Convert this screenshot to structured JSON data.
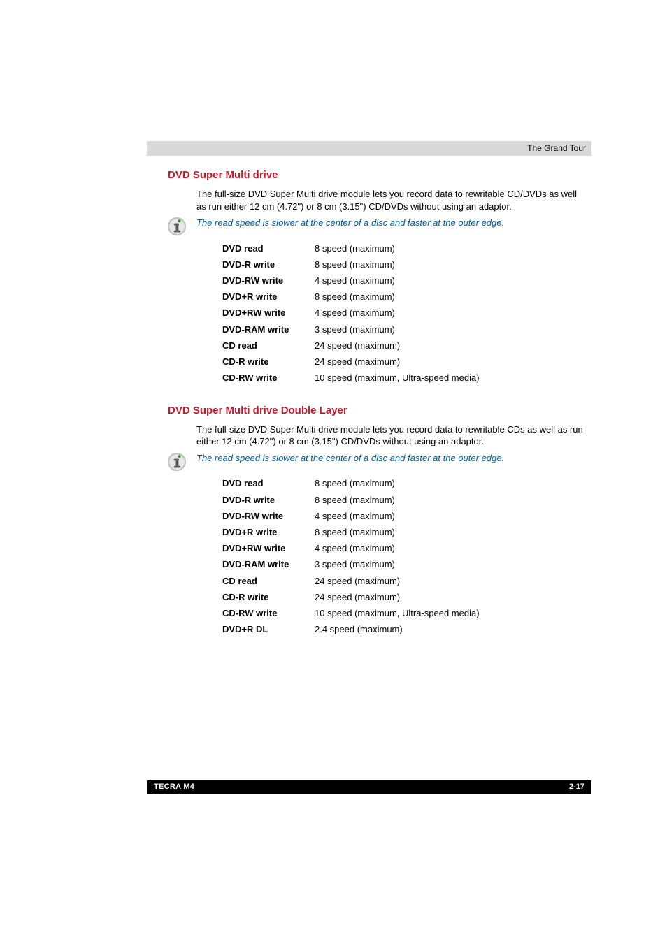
{
  "header": {
    "chapter_title": "The Grand Tour"
  },
  "sections": [
    {
      "heading": "DVD Super Multi drive",
      "description": "The full-size DVD Super Multi drive module lets you record data to rewritable CD/DVDs as well as run either 12 cm (4.72\") or 8 cm (3.15\") CD/DVDs without using an adaptor.",
      "note": "The read speed is slower at the center of a disc and faster at the outer edge.",
      "specs": [
        {
          "label": "DVD read",
          "value": "8 speed (maximum)"
        },
        {
          "label": "DVD-R write",
          "value": "8 speed (maximum)"
        },
        {
          "label": "DVD-RW write",
          "value": "4 speed (maximum)"
        },
        {
          "label": "DVD+R write",
          "value": "8 speed (maximum)"
        },
        {
          "label": "DVD+RW write",
          "value": "4 speed (maximum)"
        },
        {
          "label": "DVD-RAM write",
          "value": "3 speed (maximum)"
        },
        {
          "label": "CD read",
          "value": "24 speed (maximum)"
        },
        {
          "label": "CD-R write",
          "value": "24 speed (maximum)"
        },
        {
          "label": "CD-RW write",
          "value": "10 speed (maximum, Ultra-speed media)"
        }
      ]
    },
    {
      "heading": "DVD Super Multi drive Double Layer",
      "description": "The full-size DVD Super Multi drive module lets you record data to rewritable CDs as well as run either 12 cm (4.72\") or 8 cm (3.15\") CD/DVDs without using an adaptor.",
      "note": "The read speed is slower at the center of a disc and faster at the outer edge.",
      "specs": [
        {
          "label": "DVD read",
          "value": "8 speed (maximum)"
        },
        {
          "label": "DVD-R write",
          "value": "8 speed (maximum)"
        },
        {
          "label": "DVD-RW write",
          "value": "4 speed (maximum)"
        },
        {
          "label": "DVD+R write",
          "value": "8 speed (maximum)"
        },
        {
          "label": "DVD+RW write",
          "value": "4 speed (maximum)"
        },
        {
          "label": "DVD-RAM write",
          "value": "3 speed (maximum)"
        },
        {
          "label": "CD read",
          "value": "24 speed (maximum)"
        },
        {
          "label": "CD-R write",
          "value": "24 speed (maximum)"
        },
        {
          "label": "CD-RW write",
          "value": "10 speed (maximum, Ultra-speed media)"
        },
        {
          "label": "DVD+R DL",
          "value": "2.4 speed (maximum)"
        }
      ]
    }
  ],
  "footer": {
    "product_name": "TECRA M4",
    "page_number": "2-17"
  },
  "icons": {
    "info": "info-icon"
  }
}
